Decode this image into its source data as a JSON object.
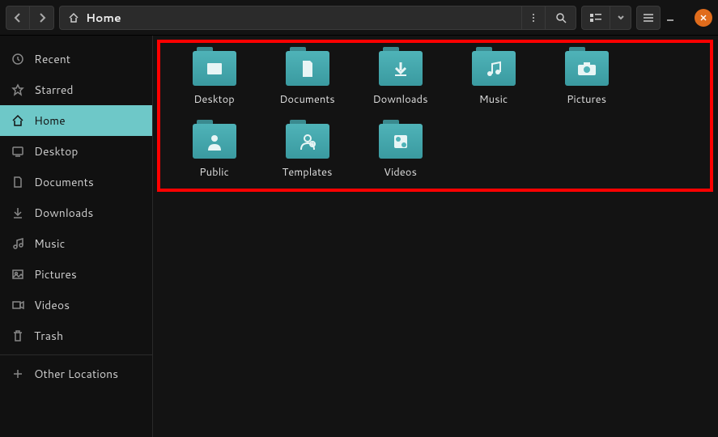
{
  "path": {
    "label": "Home"
  },
  "sidebar": {
    "recent": "Recent",
    "starred": "Starred",
    "home": "Home",
    "desktop": "Desktop",
    "documents": "Documents",
    "downloads": "Downloads",
    "music": "Music",
    "pictures": "Pictures",
    "videos": "Videos",
    "trash": "Trash",
    "other": "Other Locations"
  },
  "folders": [
    {
      "label": "Desktop",
      "icon": "desktop"
    },
    {
      "label": "Documents",
      "icon": "document"
    },
    {
      "label": "Downloads",
      "icon": "download"
    },
    {
      "label": "Music",
      "icon": "music"
    },
    {
      "label": "Pictures",
      "icon": "camera"
    },
    {
      "label": "Public",
      "icon": "person"
    },
    {
      "label": "Templates",
      "icon": "templates"
    },
    {
      "label": "Videos",
      "icon": "video"
    }
  ]
}
